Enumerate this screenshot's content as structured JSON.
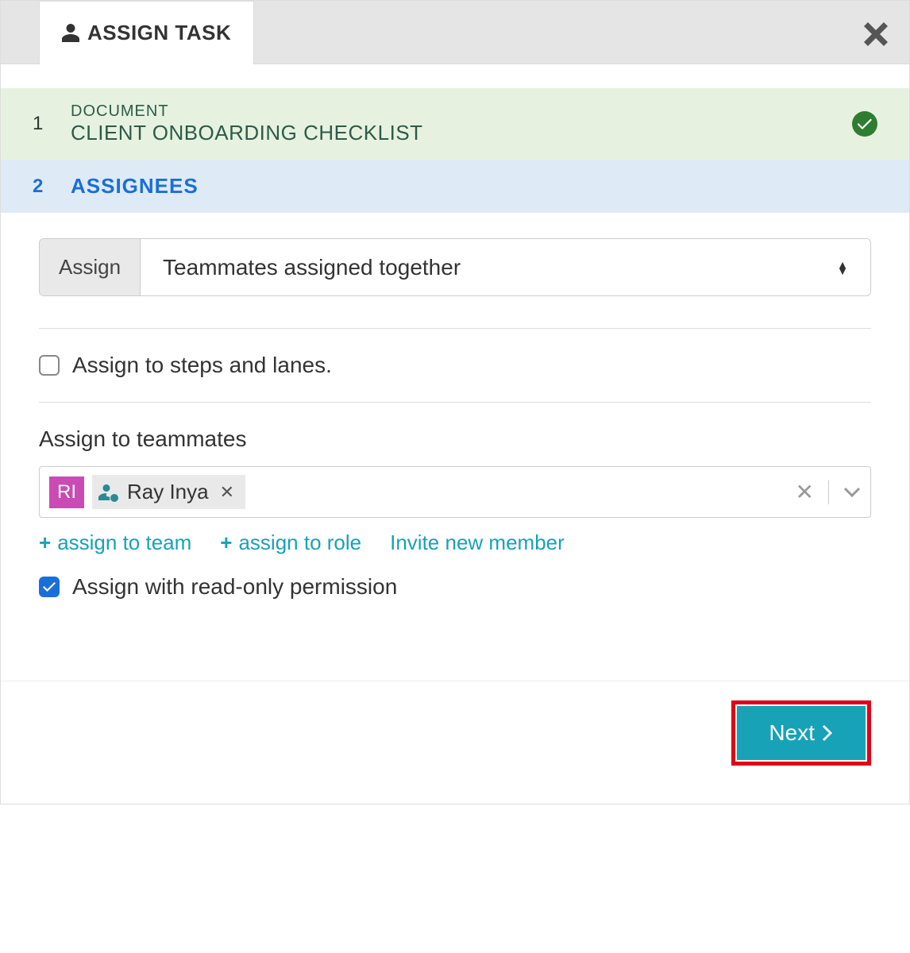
{
  "tab": {
    "title": "ASSIGN TASK"
  },
  "steps": {
    "s1": {
      "num": "1",
      "label": "DOCUMENT",
      "title": "CLIENT ONBOARDING CHECKLIST"
    },
    "s2": {
      "num": "2",
      "title": "ASSIGNEES"
    }
  },
  "assign": {
    "label": "Assign",
    "selected": "Teammates assigned together"
  },
  "options": {
    "stepsLanes": "Assign to steps and lanes.",
    "readonly": "Assign with read-only permission"
  },
  "teammates": {
    "label": "Assign to teammates",
    "badge": "RI",
    "chipName": "Ray Inya"
  },
  "links": {
    "team": "assign to team",
    "role": "assign to role",
    "invite": "Invite new member"
  },
  "footer": {
    "next": "Next"
  }
}
